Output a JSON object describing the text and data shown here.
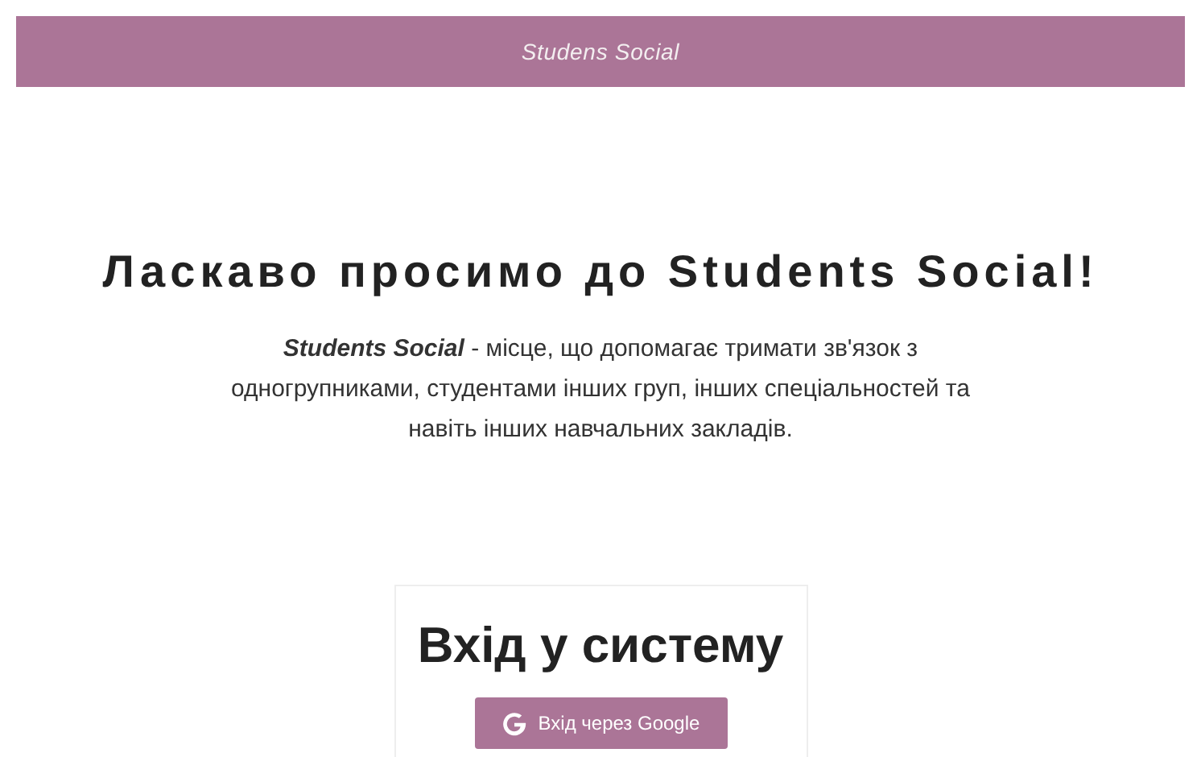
{
  "header": {
    "logo": "Studens Social"
  },
  "hero": {
    "title": "Ласкаво просимо до Students Social!",
    "description": "**Students Social** - місце, що допомагає тримати зв'язок з одногрупниками, студентами інших груп, інших спеціальностей та навіть інших навчальних закладів."
  },
  "login_card": {
    "title": "Вхід у систему",
    "button": "Вхід через Google"
  }
}
